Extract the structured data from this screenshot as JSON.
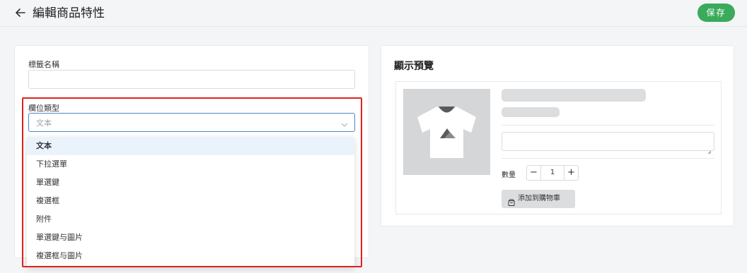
{
  "header": {
    "title": "編輯商品特性",
    "save_label": "保存"
  },
  "form": {
    "tag_name_label": "標籤名稱",
    "tag_name_value": "",
    "field_type_label": "欄位類型",
    "field_type_selected": "文本",
    "field_type_options": [
      "文本",
      "下拉選單",
      "單選鍵",
      "複選框",
      "附件",
      "單選鍵与圖片",
      "複選框与圖片"
    ]
  },
  "preview": {
    "title": "顯示預覽",
    "quantity_label": "數量",
    "quantity_value": "1",
    "minus_label": "−",
    "plus_label": "+",
    "add_to_cart_label": "添加到購物車"
  },
  "colors": {
    "accent_green": "#3aaa5c",
    "highlight_red": "#e0201f",
    "select_border": "#4f88c9",
    "selected_option_bg": "#eaf3fc"
  },
  "icons": {
    "back": "arrow-left-icon",
    "select": "chevron-down-icon",
    "product": "tshirt-placeholder-icon",
    "cart": "shopping-bag-icon"
  }
}
